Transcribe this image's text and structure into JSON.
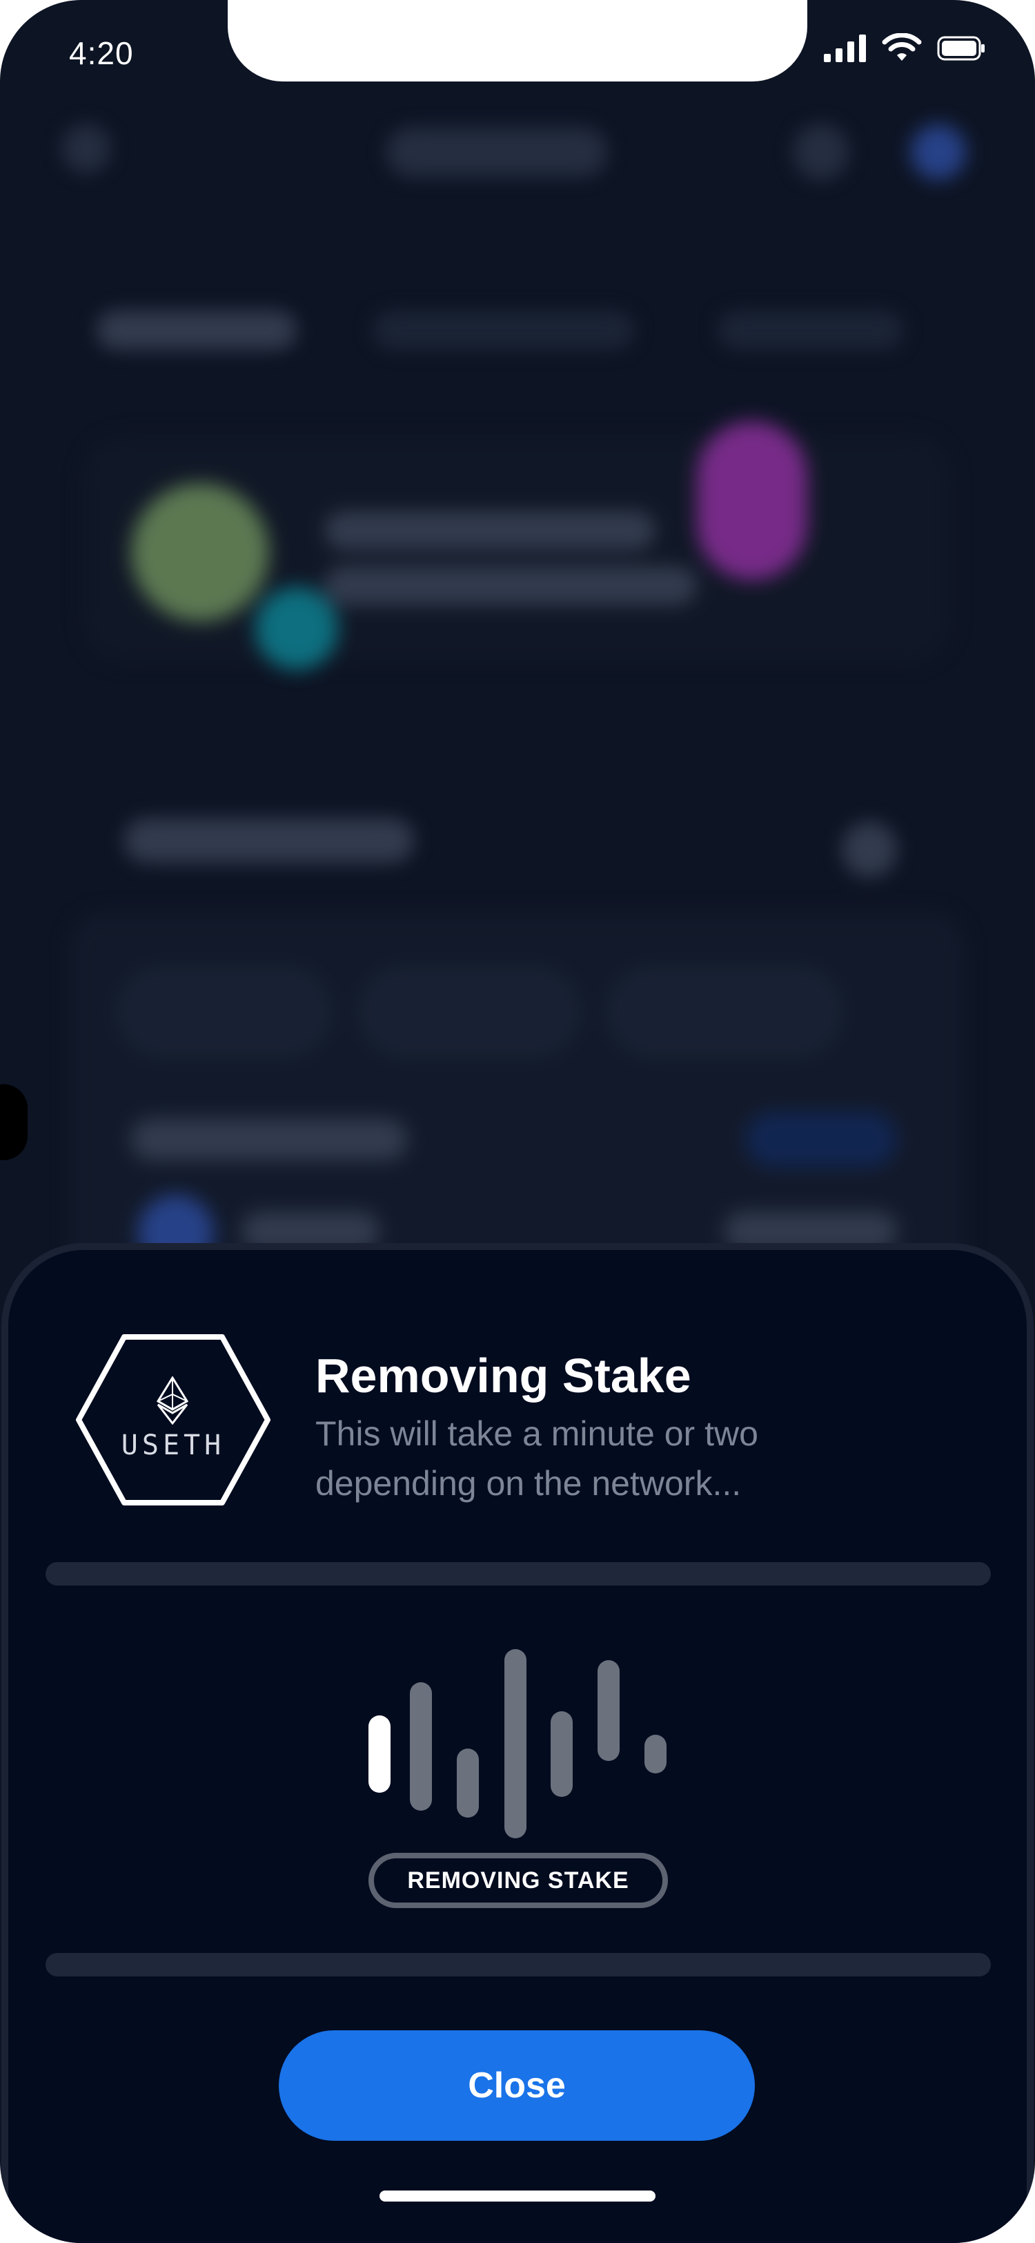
{
  "status_bar": {
    "time": "4:20"
  },
  "sheet": {
    "token_label": "USETH",
    "title": "Removing Stake",
    "subtitle": "This will take a minute or two depending on the network...",
    "status_pill": "REMOVING STAKE",
    "close_label": "Close"
  },
  "colors": {
    "background": "#0d1424",
    "sheet": "#030b1f",
    "accent": "#1a73e8",
    "muted_text": "#7d8596"
  }
}
